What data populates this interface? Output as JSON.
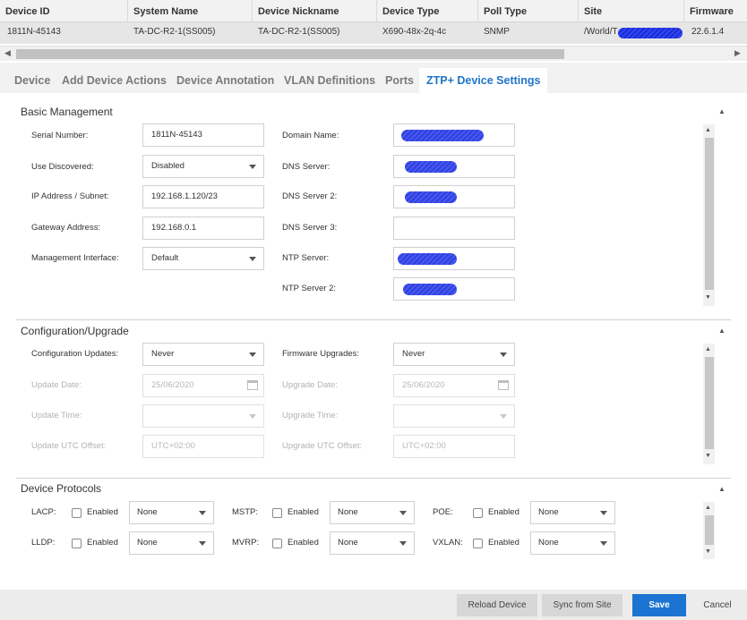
{
  "table": {
    "columns": [
      "Device ID",
      "System Name",
      "Device Nickname",
      "Device Type",
      "Poll Type",
      "Site",
      "Firmware"
    ],
    "row": [
      "1811N-45143",
      "TA-DC-R2-1(SS005)",
      "TA-DC-R2-1(SS005)",
      "X690-48x-2q-4c",
      "SNMP",
      "/World/T",
      "22.6.1.4"
    ]
  },
  "scroll": {
    "left_arrow": "◀",
    "right_arrow": "▶"
  },
  "tabs": [
    "Device",
    "Add Device Actions",
    "Device Annotation",
    "VLAN Definitions",
    "Ports",
    "ZTP+ Device Settings"
  ],
  "basic": {
    "title": "Basic Management",
    "serial_label": "Serial Number:",
    "serial_value": "1811N-45143",
    "use_discovered_label": "Use Discovered:",
    "use_discovered_value": "Disabled",
    "ip_label": "IP Address / Subnet:",
    "ip_value": "192.168.1.120/23",
    "gateway_label": "Gateway Address:",
    "gateway_value": "192.168.0.1",
    "mgmt_label": "Management Interface:",
    "mgmt_value": "Default",
    "domain_label": "Domain Name:",
    "dns1_label": "DNS Server:",
    "dns2_label": "DNS Server 2:",
    "dns3_label": "DNS Server 3:",
    "ntp1_label": "NTP Server:",
    "ntp2_label": "NTP Server 2:"
  },
  "config": {
    "title": "Configuration/Upgrade",
    "updates_label": "Configuration Updates:",
    "updates_value": "Never",
    "update_date_label": "Update Date:",
    "update_date_value": "25/06/2020",
    "update_time_label": "Update Time:",
    "update_utc_label": "Update UTC Offset:",
    "update_utc_value": "UTC+02:00",
    "fw_label": "Firmware Upgrades:",
    "fw_value": "Never",
    "upgrade_date_label": "Upgrade Date:",
    "upgrade_date_value": "25/06/2020",
    "upgrade_time_label": "Upgrade Time:",
    "upgrade_utc_label": "Upgrade UTC Offset:",
    "upgrade_utc_value": "UTC+02:00"
  },
  "protocols": {
    "title": "Device Protocols",
    "enabled_label": "Enabled",
    "items": [
      {
        "name": "LACP:",
        "value": "None"
      },
      {
        "name": "MSTP:",
        "value": "None"
      },
      {
        "name": "POE:",
        "value": "None"
      },
      {
        "name": "LLDP:",
        "value": "None"
      },
      {
        "name": "MVRP:",
        "value": "None"
      },
      {
        "name": "VXLAN:",
        "value": "None"
      }
    ]
  },
  "footer": {
    "reload": "Reload Device",
    "sync": "Sync from Site",
    "save": "Save",
    "cancel": "Cancel"
  },
  "colors": {
    "accent": "#1b74d1",
    "redaction": "#1a2bd8"
  }
}
